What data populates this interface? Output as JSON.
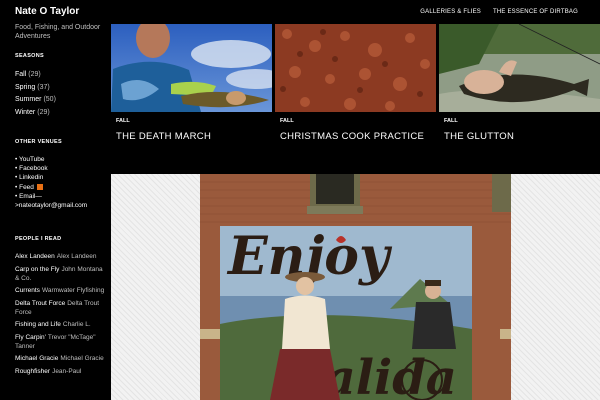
{
  "site": {
    "title": "Nate O Taylor",
    "description": "Food, Fishing, and Outdoor Adventures"
  },
  "nav": {
    "items": [
      "GALLERIES & FLIES",
      "THE ESSENCE OF DIRTBAG"
    ]
  },
  "seasons": {
    "title": "SEASONS",
    "items": [
      {
        "label": "Fall",
        "count": "(29)"
      },
      {
        "label": "Spring",
        "count": "(37)"
      },
      {
        "label": "Summer",
        "count": "(50)"
      },
      {
        "label": "Winter",
        "count": "(29)"
      }
    ]
  },
  "venues": {
    "title": "OTHER VENUES",
    "items": [
      "YouTube",
      "Facebook",
      "Linkedin",
      "Feed",
      "Email—>nateotaylor@gmail.com"
    ]
  },
  "people": {
    "title": "PEOPLE I READ",
    "items": [
      {
        "name": "Alex Landeen",
        "desc": "Alex Landeen"
      },
      {
        "name": "Carp on the Fly",
        "desc": "John Montana & Co."
      },
      {
        "name": "Currents",
        "desc": "Warmwater Flyfishing"
      },
      {
        "name": "Delta Trout Force",
        "desc": "Delta Trout Force"
      },
      {
        "name": "Fishing and Life",
        "desc": "Charlie L."
      },
      {
        "name": "Fly Carpin'",
        "desc": "Trevor \"McTage\" Tanner"
      },
      {
        "name": "Michael Gracie",
        "desc": "Michael Gracie"
      },
      {
        "name": "Roughfisher",
        "desc": "Jean-Paul"
      }
    ]
  },
  "featured": [
    {
      "category": "FALL",
      "title": "THE DEATH MARCH"
    },
    {
      "category": "FALL",
      "title": "CHRISTMAS COOK PRACTICE"
    },
    {
      "category": "FALL",
      "title": "THE GLUTTON"
    }
  ],
  "mural": {
    "text1": "Enjoy",
    "text2": "Salida"
  },
  "colors": {
    "background": "#000000",
    "brick": "#9a5a3c",
    "sky": "#3a6fc4"
  }
}
